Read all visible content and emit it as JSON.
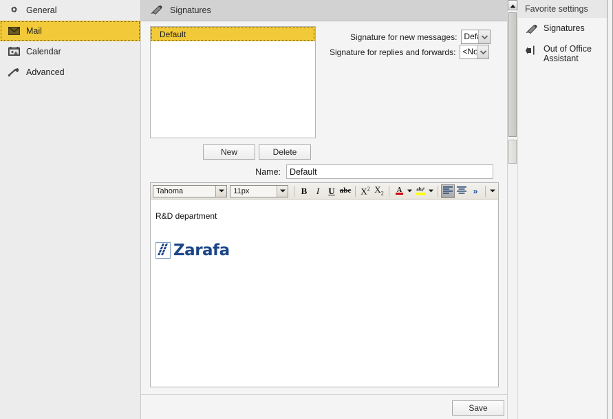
{
  "sidebar": {
    "items": [
      {
        "label": "General",
        "icon": "gear-icon",
        "selected": false
      },
      {
        "label": "Mail",
        "icon": "envelope-icon",
        "selected": true
      },
      {
        "label": "Calendar",
        "icon": "calendar-icon",
        "selected": false
      },
      {
        "label": "Advanced",
        "icon": "wrench-icon",
        "selected": false
      }
    ]
  },
  "main": {
    "header": {
      "title": "Signatures",
      "icon": "signature-pen-icon"
    },
    "signature_list": {
      "items": [
        {
          "label": "Default",
          "selected": true
        }
      ]
    },
    "combos": {
      "new_messages": {
        "label": "Signature for new messages:",
        "value": "Defa",
        "full_value": "Default"
      },
      "replies_forwards": {
        "label": "Signature for replies and forwards:",
        "value": "<No",
        "full_value": "<None>"
      }
    },
    "buttons": {
      "new": "New",
      "delete": "Delete",
      "save": "Save"
    },
    "name_field": {
      "label": "Name:",
      "value": "Default",
      "placeholder": ""
    },
    "editor": {
      "toolbar": {
        "font_family": "Tahoma",
        "font_size": "11px",
        "bold": "B",
        "italic": "I",
        "underline": "U",
        "strikethrough": "abc",
        "superscript": "X2",
        "subscript": "X2",
        "font_color": "A",
        "highlight": "ab",
        "align_left": "align-left",
        "align_center": "align-center",
        "overflow": "»"
      },
      "content": {
        "text": "R&D department",
        "logo_text": "Zarafa"
      }
    }
  },
  "right_panel": {
    "header": "Favorite settings",
    "items": [
      {
        "label": "Signatures",
        "icon": "signature-pen-icon"
      },
      {
        "label": "Out of Office Assistant",
        "icon": "out-of-office-icon"
      }
    ]
  },
  "colors": {
    "accent_yellow": "#f2c938",
    "header_gray": "#d2d2d2",
    "panel_bg": "#f4f4f4",
    "sidebar_bg": "#ececec",
    "logo_blue": "#1c4587",
    "font_color_swatch": "#cc0000",
    "highlight_swatch": "#ffff00"
  },
  "scrollbar": {
    "main": {
      "position": "top",
      "arrow": "up-arrow-icon"
    }
  }
}
